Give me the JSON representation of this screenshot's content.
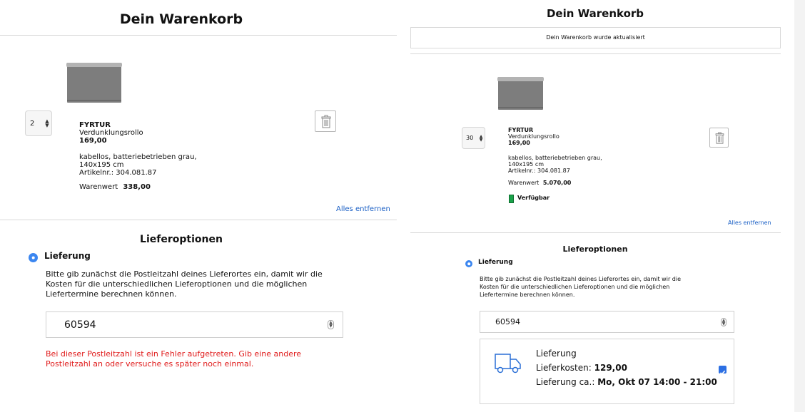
{
  "left": {
    "cart_title": "Dein Warenkorb",
    "quantity": "2",
    "product": {
      "name": "FYRTUR",
      "type": "Verdunklungsrollo",
      "price": "169,00",
      "desc_line1": "kabellos, batteriebetrieben grau,",
      "desc_line2": "140x195 cm",
      "article": "Artikelnr.: 304.081.87",
      "value_label": "Warenwert",
      "value": "338,00"
    },
    "remove_all": "Alles entfernen",
    "delivery_options_title": "Lieferoptionen",
    "delivery_radio_label": "Lieferung",
    "zip_info_line1": "Bitte gib zunächst die Postleitzahl deines Lieferortes ein, damit wir die",
    "zip_info_line2": "Kosten für die unterschiedlichen Lieferoptionen und die möglichen",
    "zip_info_line3": "Liefertermine berechnen können.",
    "zip_value": "60594",
    "error_line1": "Bei dieser Postleitzahl ist ein Fehler aufgetreten. Gib eine andere",
    "error_line2": "Postleitzahl an oder versuche es später noch einmal.",
    "error_color": "#e01b1b"
  },
  "right": {
    "cart_title": "Dein Warenkorb",
    "update_notice": "Dein Warenkorb wurde aktualisiert",
    "quantity": "30",
    "product": {
      "name": "FYRTUR",
      "type": "Verdunklungsrollo",
      "price": "169,00",
      "desc_line1": "kabellos, batteriebetrieben grau,",
      "desc_line2": "140x195 cm",
      "article": "Artikelnr.: 304.081.87",
      "value_label": "Warenwert",
      "value": "5.070,00"
    },
    "availability": "Verfügbar",
    "remove_all": "Alles entfernen",
    "delivery_options_title": "Lieferoptionen",
    "delivery_radio_label": "Lieferung",
    "zip_info_line1": "Bitte gib zunächst die Postleitzahl deines Lieferortes ein, damit wir die",
    "zip_info_line2": "Kosten für die unterschiedlichen Lieferoptionen und die möglichen",
    "zip_info_line3": "Liefertermine berechnen können.",
    "zip_value": "60594",
    "delivery": {
      "name": "Lieferung",
      "cost_label": "Lieferkosten:",
      "cost_value": "129,00",
      "date_label": "Lieferung ca.:",
      "date_value": "Mo, Okt 07 14:00 - 21:00"
    }
  },
  "colors": {
    "accent_blue": "#3b86f0",
    "link_blue": "#1a5fc5",
    "available_green": "#1aa34a"
  }
}
